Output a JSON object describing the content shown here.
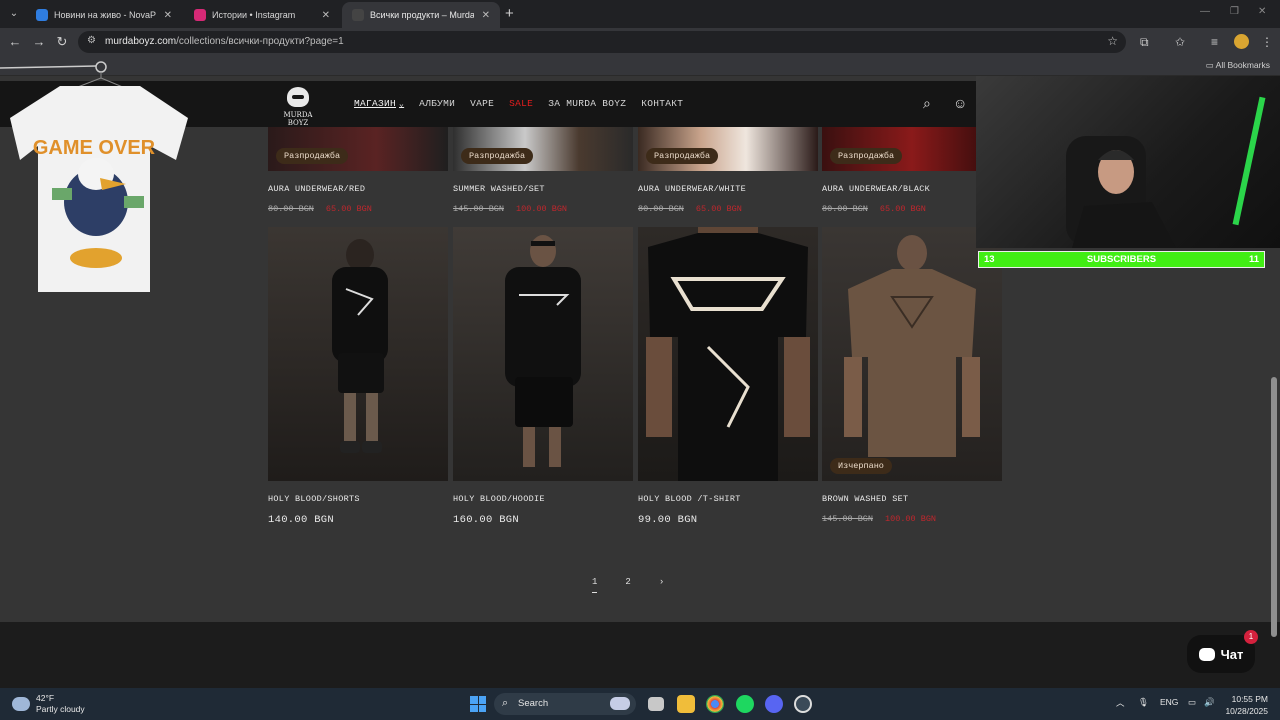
{
  "browser": {
    "tabs": [
      {
        "title": "Новини на живо - NovaPlay",
        "favicon_color": "#2f7de0",
        "active": false
      },
      {
        "title": "Истории • Instagram",
        "favicon_color": "#d62976",
        "active": false
      },
      {
        "title": "Всички продукти – Murda Boyz",
        "favicon_color": "#111111",
        "active": true
      }
    ],
    "url_host": "murdaboyz.com",
    "url_path": "/collections/всички-продукти?page=1",
    "all_bookmarks": "All Bookmarks"
  },
  "site": {
    "logo_text": "MURDA BOYZ",
    "nav": [
      {
        "label": "МАГАЗИН",
        "active": true,
        "caret": true
      },
      {
        "label": "АЛБУМИ"
      },
      {
        "label": "VAPE"
      },
      {
        "label": "SALE",
        "sale": true
      },
      {
        "label": "ЗА MURDA BOYZ"
      },
      {
        "label": "КОНТАКТ"
      }
    ],
    "top_row": [
      {
        "name": "AURA UNDERWEAR/RED",
        "badge": "Разпродажба",
        "old_price": "80.00 BGN",
        "sale_price": "65.00 BGN"
      },
      {
        "name": "SUMMER WASHED/SET",
        "badge": "Разпродажба",
        "old_price": "145.00 BGN",
        "sale_price": "100.00 BGN"
      },
      {
        "name": "AURA UNDERWEAR/WHITE",
        "badge": "Разпродажба",
        "old_price": "80.00 BGN",
        "sale_price": "65.00 BGN"
      },
      {
        "name": "AURA UNDERWEAR/BLACK",
        "badge": "Разпродажба",
        "old_price": "80.00 BGN",
        "sale_price": "65.00 BGN"
      }
    ],
    "bottom_row": [
      {
        "name": "HOLY BLOOD/SHORTS",
        "price": "140.00 BGN"
      },
      {
        "name": "HOLY BLOOD/HOODIE",
        "price": "160.00 BGN"
      },
      {
        "name": "HOLY BLOOD /T-SHIRT",
        "price": "99.00 BGN"
      },
      {
        "name": "BROWN WASHED SET",
        "badge": "Изчерпано",
        "old_price": "145.00 BGN",
        "sale_price": "100.00 BGN"
      }
    ],
    "pagination": {
      "current": "1",
      "next": "2",
      "arrow": "›"
    },
    "chat_label": "Чат",
    "chat_badge": "1"
  },
  "stream_overlay": {
    "shirt_text": "GAME OVER",
    "subs_left": "13",
    "subs_label": "SUBSCRIBERS",
    "subs_right": "11"
  },
  "taskbar": {
    "temp": "42°F",
    "condition": "Partly cloudy",
    "search_placeholder": "Search",
    "lang": "ENG",
    "time": "10:55 PM",
    "date": "10/28/2025"
  }
}
